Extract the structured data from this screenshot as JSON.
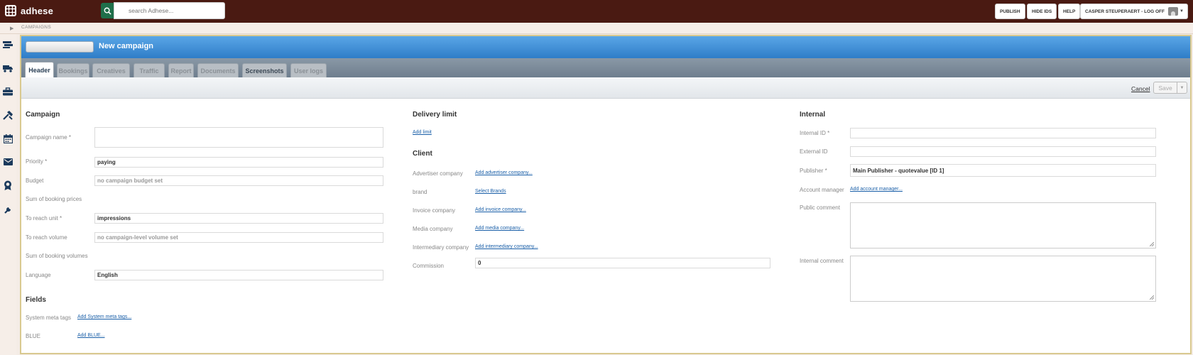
{
  "app": {
    "name": "adhese"
  },
  "search": {
    "placeholder": "search Adhese..."
  },
  "topbar": {
    "publish": "PUBLISH",
    "hide_ids": "HIDE IDS",
    "help": "HELP",
    "user": "CASPER STEUPERAERT - LOG OFF"
  },
  "breadcrumb": "CAMPAIGNS",
  "sidebar_icons": [
    "campaigns-icon",
    "delivery-truck-icon",
    "briefcase-icon",
    "tools-icon",
    "calendar-icon",
    "mail-icon",
    "award-icon",
    "wrench-icon"
  ],
  "panel": {
    "title": "New campaign",
    "tabs": [
      {
        "label": "Header",
        "state": "active"
      },
      {
        "label": "Bookings",
        "state": "disabled"
      },
      {
        "label": "Creatives",
        "state": "disabled"
      },
      {
        "label": "Traffic",
        "state": "disabled"
      },
      {
        "label": "Report",
        "state": "disabled"
      },
      {
        "label": "Documents",
        "state": "disabled"
      },
      {
        "label": "Screenshots",
        "state": "enabled"
      },
      {
        "label": "User logs",
        "state": "disabled"
      }
    ],
    "cancel": "Cancel",
    "save": "Save"
  },
  "campaign": {
    "title": "Campaign",
    "name_label": "Campaign name *",
    "name_value": "",
    "priority_label": "Priority *",
    "priority_value": "paying",
    "budget_label": "Budget",
    "budget_value": "no campaign budget set",
    "sum_prices_label": "Sum of booking prices",
    "reach_unit_label": "To reach unit *",
    "reach_unit_value": "impressions",
    "reach_volume_label": "To reach volume",
    "reach_volume_value": "no campaign-level volume set",
    "sum_volumes_label": "Sum of booking volumes",
    "language_label": "Language",
    "language_value": "English"
  },
  "fields": {
    "title": "Fields",
    "meta_label": "System meta tags",
    "meta_link": "Add System meta tags...",
    "blue_label": "BLUE",
    "blue_link": "Add BLUE..."
  },
  "delivery": {
    "title": "Delivery limit",
    "add_limit": "Add limit"
  },
  "client": {
    "title": "Client",
    "advertiser_label": "Advertiser company",
    "advertiser_link": "Add advertiser company...",
    "brand_label": "brand",
    "brand_link": "Select Brands",
    "invoice_label": "Invoice company",
    "invoice_link": "Add invoice company...",
    "media_label": "Media company",
    "media_link": "Add media company...",
    "intermediary_label": "Intermediary company",
    "intermediary_link": "Add intermediary company...",
    "commission_label": "Commission",
    "commission_value": "0"
  },
  "internal": {
    "title": "Internal",
    "internal_id_label": "Internal ID *",
    "internal_id_value": "",
    "external_id_label": "External ID",
    "external_id_value": "",
    "publisher_label": "Publisher *",
    "publisher_value": "Main Publisher - quotevalue [ID 1]",
    "account_manager_label": "Account manager",
    "account_manager_link": "Add account manager...",
    "public_comment_label": "Public comment",
    "internal_comment_label": "Internal comment"
  }
}
